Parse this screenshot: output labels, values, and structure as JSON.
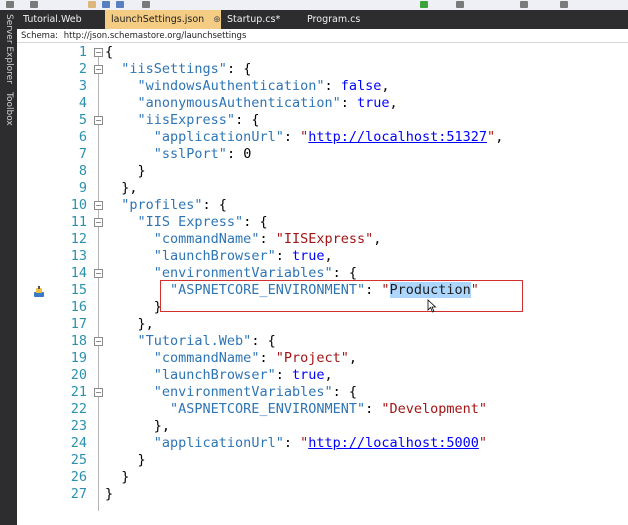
{
  "tabs": [
    {
      "label": "Tutorial.Web",
      "active": false
    },
    {
      "label": "launchSettings.json",
      "active": true,
      "pin": "⊕",
      "close": "✕"
    },
    {
      "label": "Startup.cs*",
      "active": false
    },
    {
      "label": "Program.cs",
      "active": false
    }
  ],
  "sidebar": {
    "server_explorer": "Server Explorer",
    "toolbox": "Toolbox"
  },
  "schema": {
    "label": "Schema:",
    "url": "http://json.schemastore.org/launchsettings"
  },
  "editor": {
    "line_numbers": [
      "1",
      "2",
      "3",
      "4",
      "5",
      "6",
      "7",
      "8",
      "9",
      "10",
      "11",
      "12",
      "13",
      "14",
      "15",
      "16",
      "17",
      "18",
      "19",
      "20",
      "21",
      "22",
      "23",
      "24",
      "25",
      "26",
      "27"
    ],
    "keys": {
      "iisSettings": "\"iisSettings\"",
      "windowsAuthentication": "\"windowsAuthentication\"",
      "anonymousAuthentication": "\"anonymousAuthentication\"",
      "iisExpress": "\"iisExpress\"",
      "applicationUrl": "\"applicationUrl\"",
      "sslPort": "\"sslPort\"",
      "profiles": "\"profiles\"",
      "iis_express_profile": "\"IIS Express\"",
      "commandName": "\"commandName\"",
      "launchBrowser": "\"launchBrowser\"",
      "environmentVariables": "\"environmentVariables\"",
      "aspnetcore_env": "\"ASPNETCORE_ENVIRONMENT\"",
      "tutorial_web_profile": "\"Tutorial.Web\""
    },
    "values": {
      "false": "false",
      "true": "true",
      "url_51327": "http://localhost:51327",
      "ssl_port": "0",
      "iisexpress_cmd": "\"IISExpress\"",
      "production": "Production",
      "project_cmd": "\"Project\"",
      "development": "\"Development\"",
      "url_5000": "http://localhost:5000"
    }
  },
  "colors": {
    "active_tab": "#f5cc84",
    "key": "#2e75b6",
    "string": "#a31515",
    "keyword": "#0000ff",
    "line_number": "#2b91af",
    "highlight_box": "#d32f2f",
    "selection": "#add6ff"
  }
}
